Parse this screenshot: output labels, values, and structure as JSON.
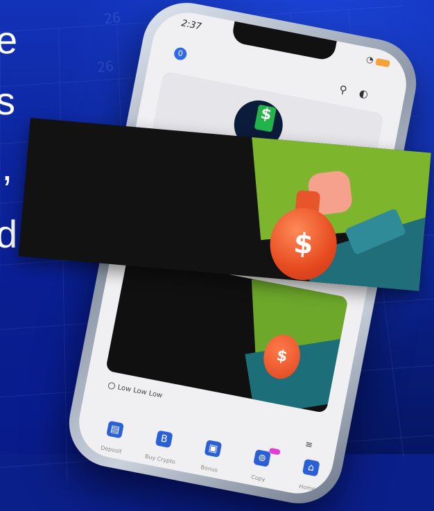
{
  "hero_text": {
    "lines": [
      "e",
      "s",
      "l,",
      "d"
    ]
  },
  "background_numbers": [
    "26",
    "26"
  ],
  "phone": {
    "status_time": "2:37",
    "app_logo_letter": "0",
    "ticker_text": "Low Low Low",
    "menu_glyph": "≡",
    "nav_items": [
      {
        "label": "Deposit",
        "icon": "deposit-icon",
        "glyph": "▤"
      },
      {
        "label": "Buy Crypto",
        "icon": "buy-crypto-icon",
        "glyph": "B"
      },
      {
        "label": "Bonus",
        "icon": "bonus-icon",
        "glyph": "▣"
      },
      {
        "label": "Copy",
        "icon": "copy-icon",
        "glyph": "⊚"
      },
      {
        "label": "Home",
        "icon": "home-icon",
        "glyph": "⌂"
      }
    ]
  },
  "colors": {
    "background": "#0b1f8a",
    "accent_green": "#7db52c",
    "accent_teal": "#1f6e7a",
    "bag_orange": "#e64a1f"
  }
}
